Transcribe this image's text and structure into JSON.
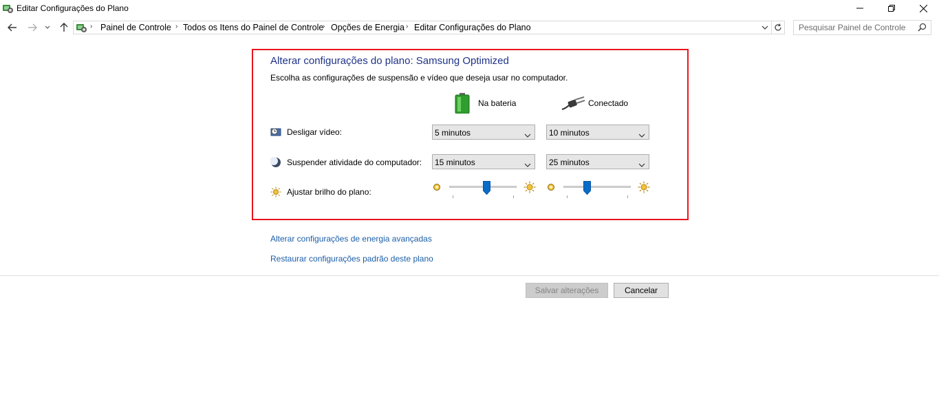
{
  "window": {
    "title": "Editar Configurações do Plano"
  },
  "address_bar": {
    "crumbs": [
      "Painel de Controle",
      "Todos os Itens do Painel de Controle",
      "Opções de Energia",
      "Editar Configurações do Plano"
    ]
  },
  "search": {
    "placeholder": "Pesquisar Painel de Controle"
  },
  "plan": {
    "title": "Alterar configurações do plano: Samsung Optimized",
    "description": "Escolha as configurações de suspensão e vídeo que deseja usar no computador.",
    "columns": {
      "battery": "Na bateria",
      "plugged": "Conectado"
    },
    "rows": {
      "display_off": {
        "label": "Desligar vídeo:",
        "battery": "5 minutos",
        "plugged": "10 minutos"
      },
      "sleep": {
        "label": "Suspender atividade do computador:",
        "battery": "15 minutos",
        "plugged": "25 minutos"
      },
      "brightness": {
        "label": "Ajustar brilho do plano:",
        "battery_level_pct": 56,
        "plugged_level_pct": 33
      }
    }
  },
  "links": {
    "advanced": "Alterar configurações de energia avançadas",
    "restore": "Restaurar configurações padrão deste plano"
  },
  "buttons": {
    "save": "Salvar alterações",
    "cancel": "Cancelar"
  },
  "colors": {
    "title": "#1e3287",
    "link": "#1a5ea8",
    "highlight": "#e8141b",
    "slider_thumb": "#0a6cc8"
  }
}
